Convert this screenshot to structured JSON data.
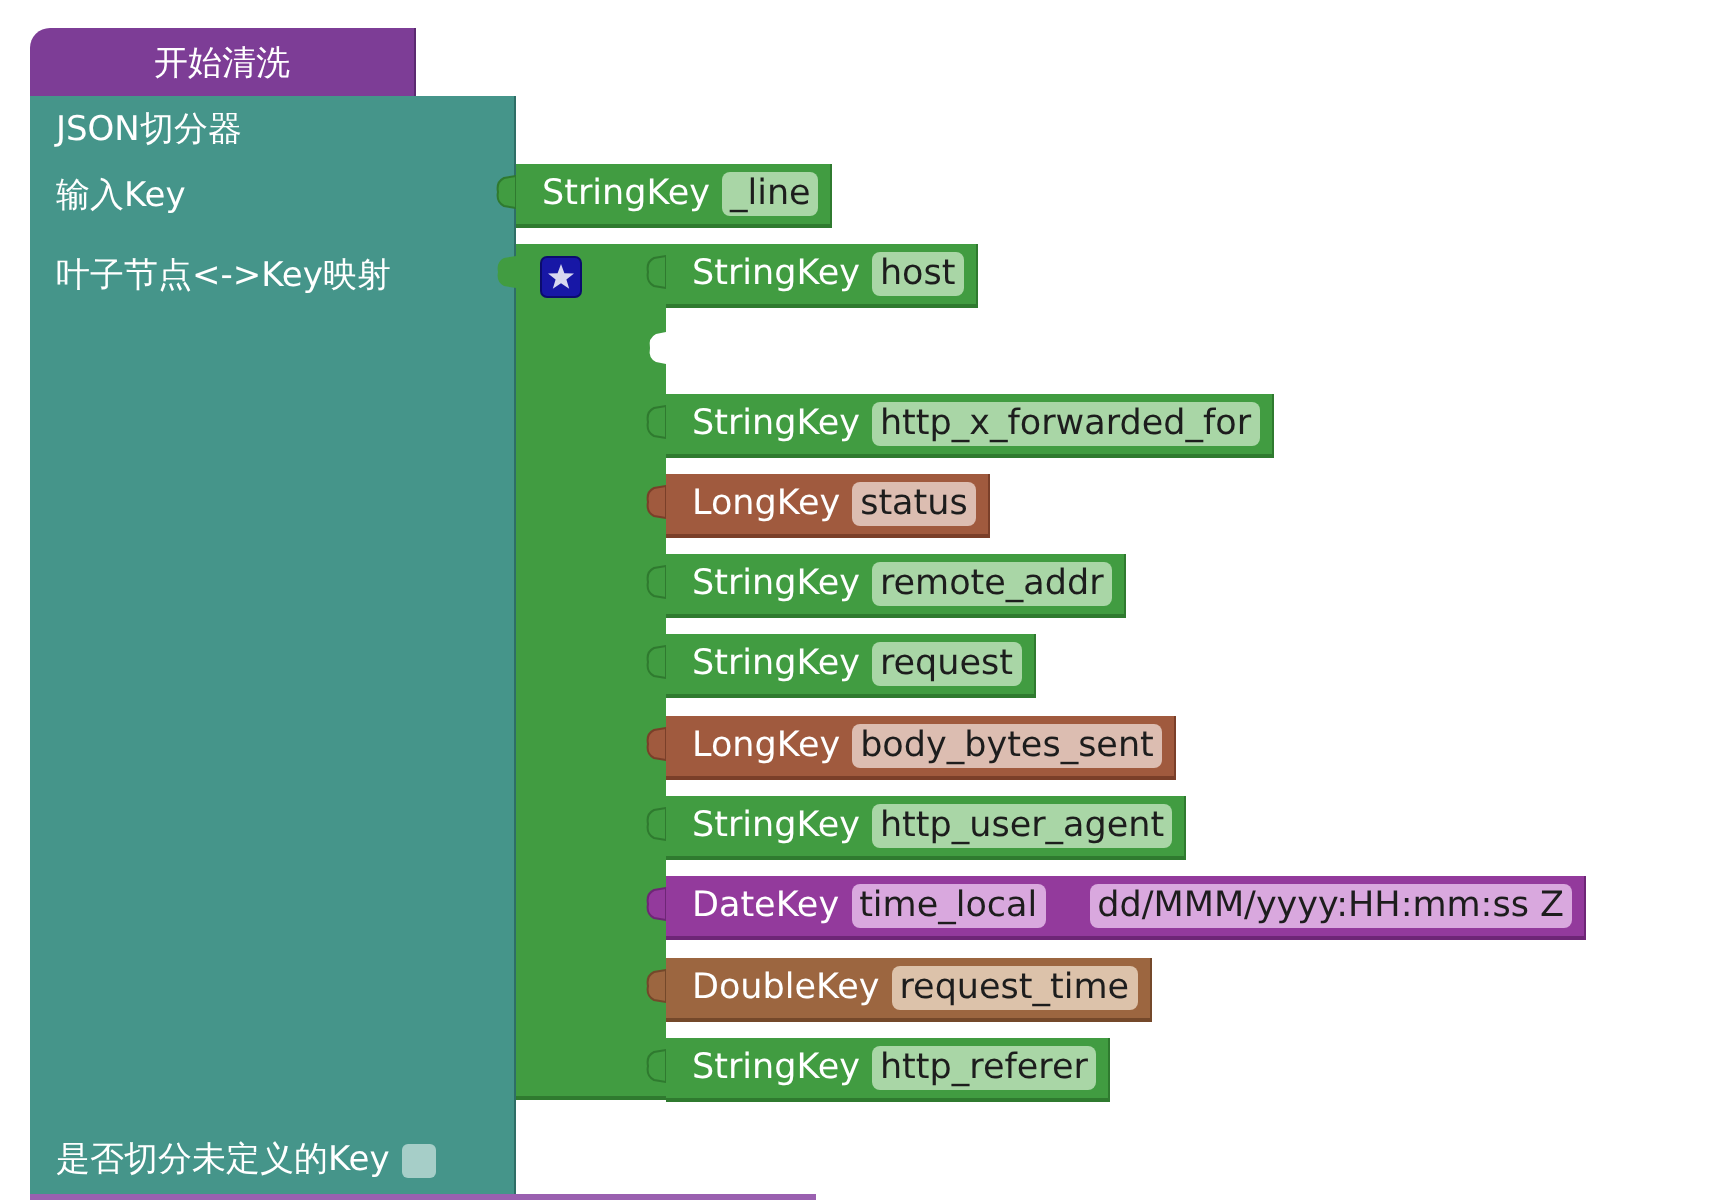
{
  "hat_block": {
    "label": "开始清洗"
  },
  "splitter_block": {
    "title": "JSON切分器",
    "input_label": "输入Key",
    "input_key": {
      "kind": "string",
      "type": "StringKey",
      "name": "_line"
    },
    "mapping_label": "叶子节点<->Key映射",
    "mapping_items": [
      {
        "kind": "string",
        "type": "StringKey",
        "name": "host"
      },
      {
        "kind": "empty"
      },
      {
        "kind": "string",
        "type": "StringKey",
        "name": "http_x_forwarded_for"
      },
      {
        "kind": "long",
        "type": "LongKey",
        "name": "status"
      },
      {
        "kind": "string",
        "type": "StringKey",
        "name": "remote_addr"
      },
      {
        "kind": "string",
        "type": "StringKey",
        "name": "request"
      },
      {
        "kind": "long",
        "type": "LongKey",
        "name": "body_bytes_sent"
      },
      {
        "kind": "string",
        "type": "StringKey",
        "name": "http_user_agent"
      },
      {
        "kind": "date",
        "type": "DateKey",
        "name": "time_local",
        "format": "dd/MMM/yyyy:HH:mm:ss Z"
      },
      {
        "kind": "double",
        "type": "DoubleKey",
        "name": "request_time"
      },
      {
        "kind": "string",
        "type": "StringKey",
        "name": "http_referer"
      }
    ],
    "split_undefined": {
      "label": "是否切分未定义的Key",
      "checked": false
    }
  }
}
